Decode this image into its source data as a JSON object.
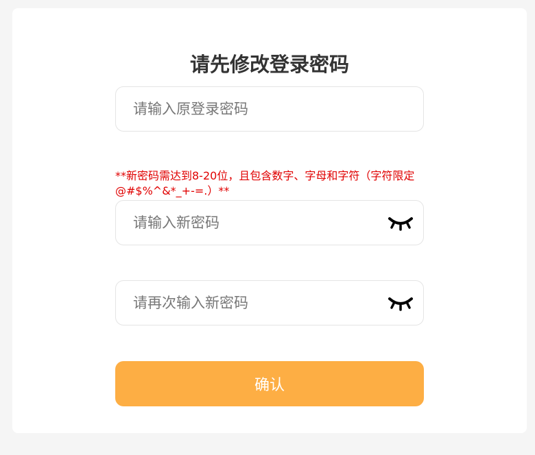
{
  "title": "请先修改登录密码",
  "old_password": {
    "placeholder": "请输入原登录密码"
  },
  "hint": "**新密码需达到8-20位，且包含数字、字母和字符（字符限定@#$%^&*_+-=.）**",
  "new_password": {
    "placeholder": "请输入新密码",
    "toggle_icon": "eye-closed-icon"
  },
  "confirm_password": {
    "placeholder": "请再次输入新密码",
    "toggle_icon": "eye-closed-icon"
  },
  "confirm_button": {
    "label": "确认",
    "color": "#fdae44"
  },
  "colors": {
    "hint": "#e00000",
    "background": "#f5f5f5",
    "card": "#ffffff"
  }
}
